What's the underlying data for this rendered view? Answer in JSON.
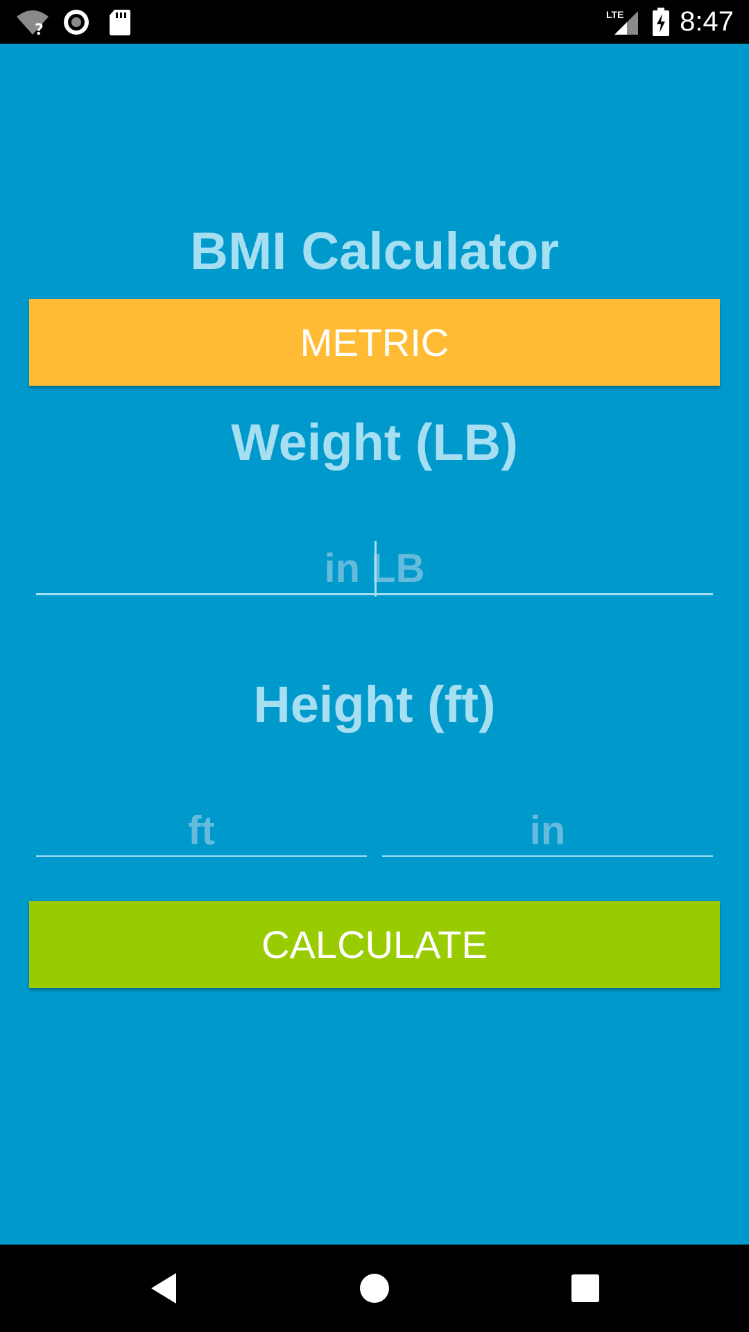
{
  "status_bar": {
    "time": "8:47",
    "network_label": "LTE",
    "icons": [
      "wifi-question-icon",
      "record-icon",
      "sd-card-icon",
      "signal-icon",
      "battery-charging-icon"
    ]
  },
  "app": {
    "title": "BMI Calculator",
    "unit_toggle_label": "METRIC",
    "weight_label": "Weight (LB)",
    "weight_placeholder": "in LB",
    "height_label": "Height (ft)",
    "height_ft_placeholder": "ft",
    "height_in_placeholder": "in",
    "calculate_label": "CALCULATE"
  },
  "colors": {
    "background": "#0099cc",
    "metric_button": "#ffbb33",
    "calculate_button": "#99cc00",
    "label_text": "#a6def2"
  },
  "nav_bar": {
    "icons": [
      "back-icon",
      "home-icon",
      "recents-icon"
    ]
  }
}
